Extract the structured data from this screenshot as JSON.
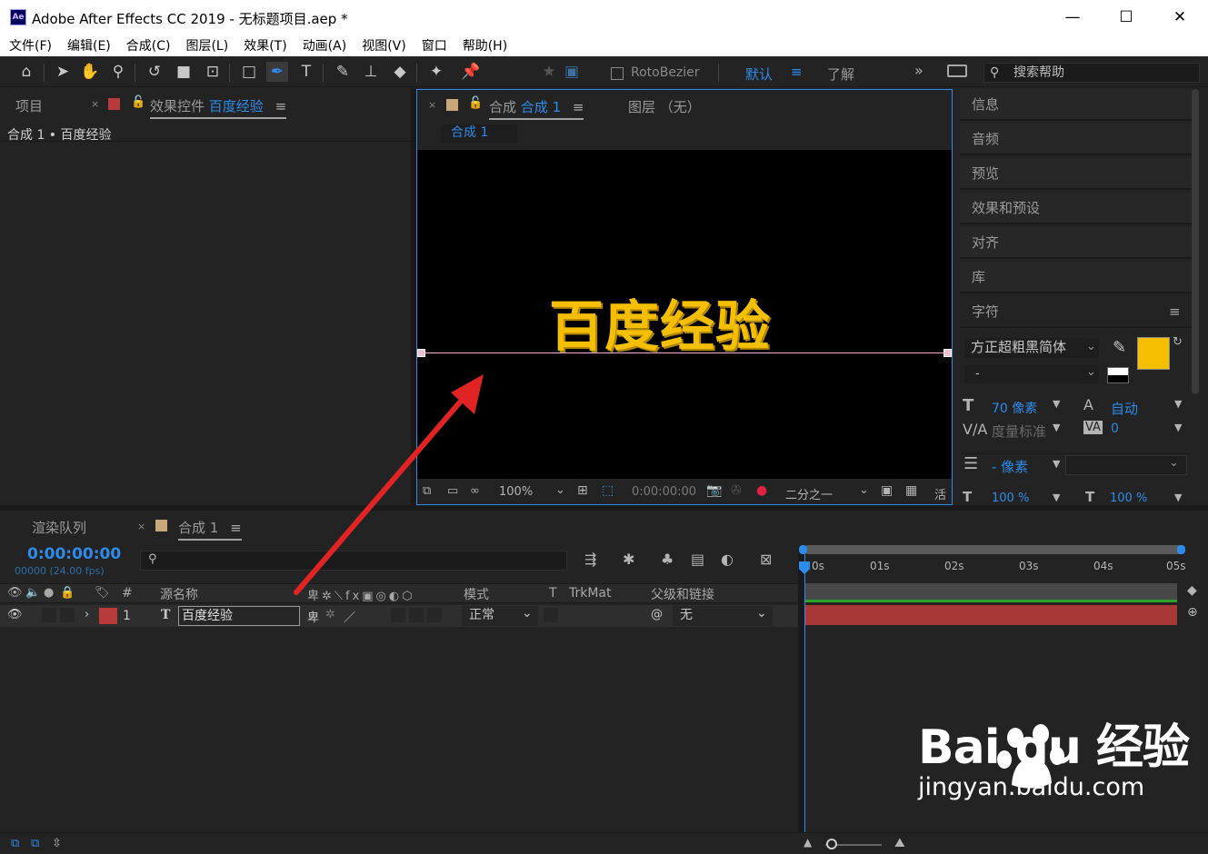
{
  "window": {
    "title": "Adobe After Effects CC 2019 - 无标题项目.aep *",
    "app_icon": "Ae",
    "minimize": "—",
    "maximize": "☐",
    "close": "✕"
  },
  "menu": [
    "文件(F)",
    "编辑(E)",
    "合成(C)",
    "图层(L)",
    "效果(T)",
    "动画(A)",
    "视图(V)",
    "窗口",
    "帮助(H)"
  ],
  "toolbar": {
    "rotobezier": "RotoBezier",
    "workspace_default": "默认",
    "workspace_learn": "了解",
    "search_placeholder": "搜索帮助"
  },
  "project_panel": {
    "tab_project": "项目",
    "tab_effects": "效果控件",
    "tab_effects_target": "百度经验",
    "breadcrumb": "合成 1 • 百度经验"
  },
  "comp_panel": {
    "tab_label": "合成",
    "tab_comp_name": "合成 1",
    "tab_layer": "图层 （无）",
    "subtab": "合成 1",
    "text_content": "百度经验",
    "zoom": "100%",
    "timecode": "0:00:00:00",
    "resolution": "二分之一",
    "active_camera": "活"
  },
  "right_panel": {
    "items": [
      "信息",
      "音频",
      "预览",
      "效果和预设",
      "对齐",
      "库"
    ],
    "character_title": "字符",
    "font_name": "方正超粗黑简体",
    "font_style": "-",
    "font_size": "70 像素",
    "leading": "自动",
    "kerning": "度量标准",
    "tracking": "0",
    "line_spacing": "- 像素",
    "vscale": "100 %",
    "hscale": "100 %",
    "fill_color": "#f5bf00"
  },
  "timeline": {
    "tab_render": "渲染队列",
    "tab_comp": "合成 1",
    "timecode": "0:00:00:00",
    "fps": "00000 (24.00 fps)",
    "columns": {
      "hash": "#",
      "source_name": "源名称",
      "mode": "模式",
      "t": "T",
      "trkmat": "TrkMat",
      "parent": "父级和链接"
    },
    "layer": {
      "number": "1",
      "type_icon": "T",
      "name": "百度经验",
      "mode": "正常",
      "parent": "无",
      "label_color": "#b83a3a"
    },
    "ruler": [
      "0s",
      "01s",
      "02s",
      "03s",
      "04s",
      "05s"
    ]
  },
  "watermark": {
    "brand": "Bai  du 经验",
    "url": "jingyan.baidu.com"
  }
}
